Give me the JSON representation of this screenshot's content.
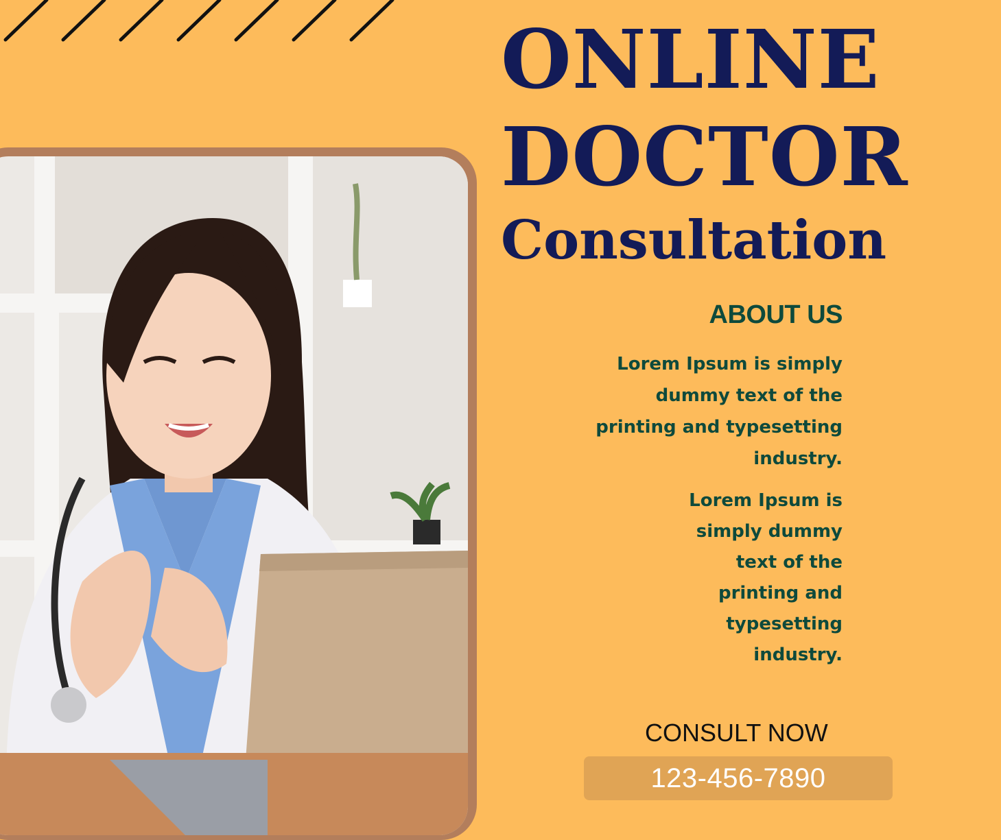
{
  "headline": {
    "line1": "ONLINE",
    "line2": "DOCTOR",
    "line3": "Consultation"
  },
  "about": {
    "title": "ABOUT US",
    "paragraph1": "Lorem Ipsum is simply dummy text of the printing and typesetting industry.",
    "paragraph2": "Lorem Ipsum is simply dummy text of the printing and typesetting industry."
  },
  "cta": {
    "label": "CONSULT NOW",
    "phone": "123-456-7890"
  },
  "colors": {
    "background": "#fdbb5b",
    "headline": "#131b57",
    "body_text": "#0e4a3c",
    "photo_frame": "#b37e5c",
    "phone_button": "#e0a455"
  },
  "photo": {
    "icon": "doctor-video-call-photo"
  }
}
